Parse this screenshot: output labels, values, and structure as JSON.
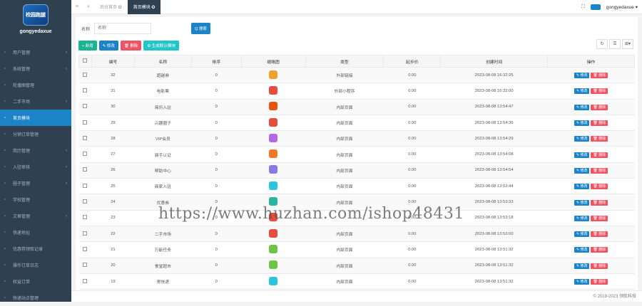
{
  "sidebar": {
    "logo_text": "校园跑腿",
    "username": "gongyedaxue",
    "items": [
      {
        "label": "用户管理",
        "arrow": "‹"
      },
      {
        "label": "系统管理",
        "arrow": "‹"
      },
      {
        "label": "轮播图管理",
        "arrow": ""
      },
      {
        "label": "二手市场",
        "arrow": "‹"
      },
      {
        "label": "首页模块",
        "arrow": ""
      },
      {
        "label": "分销订单管理",
        "arrow": ""
      },
      {
        "label": "简历管理",
        "arrow": "‹"
      },
      {
        "label": "入驻审核",
        "arrow": "‹"
      },
      {
        "label": "圈子管理",
        "arrow": "‹"
      },
      {
        "label": "学校管理",
        "arrow": ""
      },
      {
        "label": "文章管理",
        "arrow": "‹"
      },
      {
        "label": "快递地址",
        "arrow": ""
      },
      {
        "label": "优惠券领取记录",
        "arrow": ""
      },
      {
        "label": "操作订单日志",
        "arrow": ""
      },
      {
        "label": "权益订单",
        "arrow": ""
      },
      {
        "label": "快递站点管理",
        "arrow": ""
      }
    ]
  },
  "topbar": {
    "tabs": [
      {
        "label": "后台首页 ✪"
      },
      {
        "label": "首页模块 ✪"
      }
    ],
    "user": "gongyedaxue ▾"
  },
  "search": {
    "label": "名称",
    "placeholder": "名称",
    "button": "Q 搜索"
  },
  "toolbar": {
    "add": "+ 新增",
    "edit": "✎ 修改",
    "delete": "🗑 删除",
    "gen": "⚙ 生成默认模块"
  },
  "table": {
    "headers": [
      "",
      "编号",
      "名称",
      "排序",
      "缩略图",
      "类型",
      "起步价",
      "创建时间",
      "操作"
    ],
    "rows": [
      {
        "id": "32",
        "name": "超越券",
        "sort": "0",
        "type": "外部链接",
        "price": "0.00",
        "created": "2023-08-08 16:32:25",
        "color": "#f0a030"
      },
      {
        "id": "31",
        "name": "电影票",
        "sort": "0",
        "type": "外部小程序",
        "price": "0.00",
        "created": "2023-08-08 16:32:00",
        "color": "#e84c3d"
      },
      {
        "id": "30",
        "name": "简历入驻",
        "sort": "0",
        "type": "内部页面",
        "price": "0.00",
        "created": "2023-08-08 13:54:47",
        "color": "#e8530e"
      },
      {
        "id": "29",
        "name": "兴趣圈子",
        "sort": "0",
        "type": "内部页面",
        "price": "0.00",
        "created": "2023-08-08 13:54:36",
        "color": "#e84c3d"
      },
      {
        "id": "28",
        "name": "VIP会员",
        "sort": "0",
        "type": "内部页面",
        "price": "0.00",
        "created": "2023-08-08 13:54:29",
        "color": "#b36ae2"
      },
      {
        "id": "27",
        "name": "骑手认证",
        "sort": "0",
        "type": "内部页面",
        "price": "0.00",
        "created": "2023-08-08 13:54:08",
        "color": "#f07a28"
      },
      {
        "id": "26",
        "name": "帮助中心",
        "sort": "0",
        "type": "内部页面",
        "price": "0.00",
        "created": "2023-08-08 13:54:54",
        "color": "#8a7ae8"
      },
      {
        "id": "25",
        "name": "商家入驻",
        "sort": "0",
        "type": "内部页面",
        "price": "0.00",
        "created": "2023-08-08 13:53:44",
        "color": "#2bc4e0"
      },
      {
        "id": "24",
        "name": "优惠券",
        "sort": "0",
        "type": "内部页面",
        "price": "0.00",
        "created": "2023-08-08 13:53:33",
        "color": "#2bb5a0"
      },
      {
        "id": "23",
        "name": "",
        "sort": "0",
        "type": "",
        "price": "0.00",
        "created": "2023-08-08 13:53:18",
        "color": "#e84c3d"
      },
      {
        "id": "22",
        "name": "二手市场",
        "sort": "0",
        "type": "内部页面",
        "price": "0.00",
        "created": "2023-08-08 13:53:00",
        "color": "#e84c3d"
      },
      {
        "id": "21",
        "name": "万能任务",
        "sort": "0",
        "type": "内部页面",
        "price": "0.00",
        "created": "2023-08-08 13:51:32",
        "color": "#6cc644"
      },
      {
        "id": "20",
        "name": "食堂超市",
        "sort": "0",
        "type": "内部页面",
        "price": "0.00",
        "created": "2023-08-08 13:51:32",
        "color": "#6cc644"
      },
      {
        "id": "19",
        "name": "寄快递",
        "sort": "0",
        "type": "内部页面",
        "price": "0.00",
        "created": "2023-08-08 13:51:32",
        "color": "#2bc4e0"
      }
    ],
    "edit_label": "✎ 修改",
    "delete_label": "🗑 删除"
  },
  "footer": "© 2019-2023 领航科技",
  "watermark": "https://www.huzhan.com/ishop48431"
}
